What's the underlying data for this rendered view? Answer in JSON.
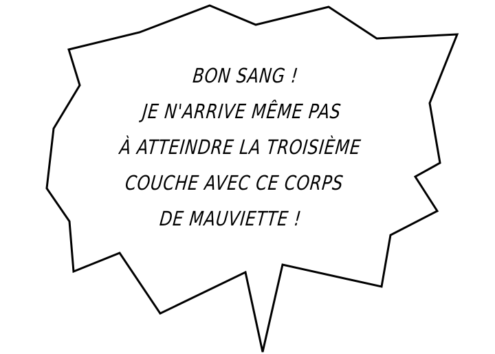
{
  "speech_bubble": {
    "lines": [
      "BON SANG !",
      "JE N'ARRIVE MÊME PAS",
      "À ATTEINDRE LA TROISIÈME",
      "COUCHE AVEC CE CORPS",
      "DE MAUVIETTE !"
    ]
  },
  "colors": {
    "background": "#ffffff",
    "bubble_fill": "#ffffff",
    "outline": "#000000",
    "text": "#000000"
  }
}
